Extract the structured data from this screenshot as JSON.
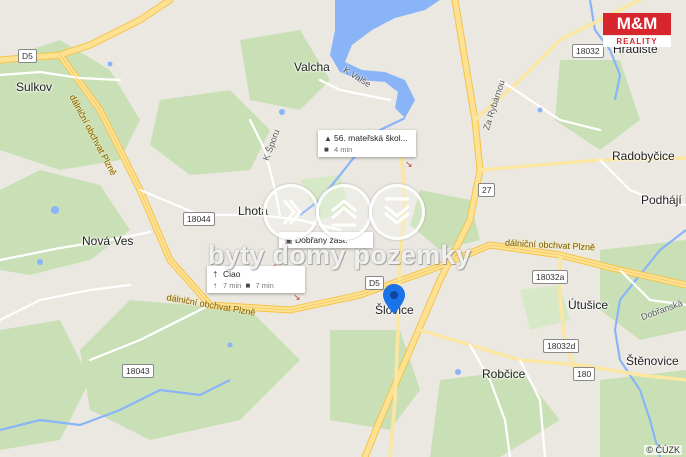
{
  "logo": {
    "top": "M&M",
    "bottom": "REALITY"
  },
  "watermark": "byty domy pozemky",
  "places": {
    "sulkov": "Sulkov",
    "valcha": "Valcha",
    "hradiste": "Hradiště",
    "radobycice": "Radobyčice",
    "podhaji": "Podhájí",
    "lhota": "Lhota",
    "nova_ves": "Nová Ves",
    "utusice": "Útušice",
    "slovice": "Šlovice",
    "robcice": "Robčice",
    "stenovice": "Štěnovice"
  },
  "streets": {
    "k_valse": "K Valše",
    "k_sporu": "K Šporu",
    "za_rybarnou": "Za Rybárnou",
    "obchvat_left": "dálniční obchvat Plzně",
    "obchvat_bottom": "dálniční obchvat Plzně",
    "obchvat_right": "dálniční obchvat Plzně",
    "dobranska": "Dobřanská"
  },
  "shields": {
    "d5_top": "D5",
    "d5_mid": "D5",
    "r18044": "18044",
    "r18043": "18043",
    "r18032_top": "18032",
    "r18032a": "18032a",
    "r18032d": "18032d",
    "r27": "27",
    "r180": "180"
  },
  "cards": {
    "school": {
      "title": "56. mateřská škol...",
      "time": "4 min"
    },
    "bus": {
      "title": "Dobřany zast."
    },
    "restaurant": {
      "title": "Ciao",
      "walk": "7 min",
      "drive": "7 min"
    }
  },
  "copyright": "© ČÚZK",
  "colors": {
    "water": "#8ab4f8",
    "forest": "#c8dfb4",
    "highway": "#fbd46a",
    "road": "#ffffff",
    "brand_red": "#d7262e",
    "pin": "#1a73e8"
  },
  "icons": {
    "school": "graduation-cap-icon",
    "car": "car-icon",
    "bus": "bus-icon",
    "food": "fork-knife-icon",
    "walk": "walking-icon"
  }
}
